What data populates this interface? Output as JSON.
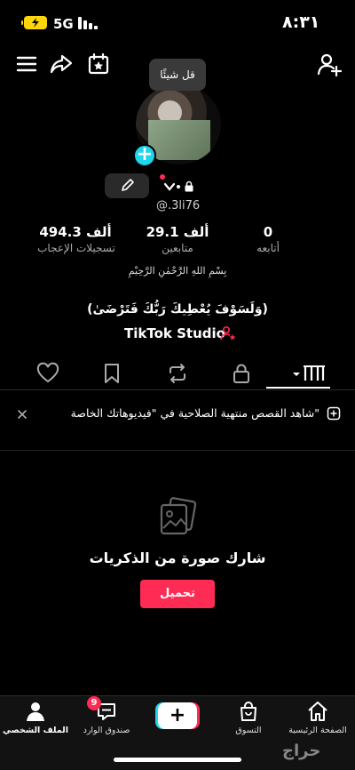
{
  "status_bar": {
    "time": "٨:٣١",
    "network": "5G"
  },
  "tooltip": {
    "text": "قل شيئًا"
  },
  "profile": {
    "username": "@.3li76",
    "basmala": "بِسْمِ اللهِ الرَّحْمٰنِ الرَّحِيْمِ",
    "bio": "(وَلَسَوْفَ يُعْطِيكَ رَبُّكَ فَتَرْضَىٰ)",
    "studio_label": "TikTok Studio"
  },
  "stats": {
    "following": {
      "value": "0",
      "label": "أتابعه"
    },
    "followers": {
      "value": "29.1 ألف",
      "label": "متابعين"
    },
    "likes": {
      "value": "494.3 ألف",
      "label": "تسجيلات الإعجاب"
    }
  },
  "notice": {
    "text": "شاهد القصص منتهية الصلاحية في \"فيديوهاتك الخاصة\""
  },
  "empty_state": {
    "title": "شارك صورة من الذكريات",
    "button": "تحميل"
  },
  "bottom_nav": {
    "home": "الصفحة الرئيسية",
    "shop": "التسوق",
    "inbox": "صندوق الوارد",
    "inbox_badge": "9",
    "profile": "الملف الشخصي"
  },
  "watermark": "حراج",
  "colors": {
    "accent": "#fe2c55",
    "cyan": "#20d5ec",
    "battery": "#ffd60a"
  }
}
